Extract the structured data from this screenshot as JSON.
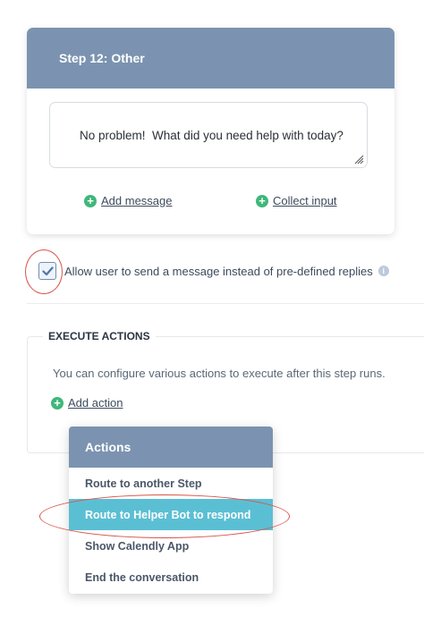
{
  "step": {
    "title": "Step 12: Other",
    "message": "No problem!  What did you need help with today?",
    "add_message_label": "Add message",
    "collect_input_label": "Collect input"
  },
  "settings": {
    "allow_user_message_label": "Allow user to send a message instead of pre-defined replies",
    "allow_user_message_checked": true
  },
  "execute_actions": {
    "title": "EXECUTE ACTIONS",
    "description": "You can configure various actions to execute after this step runs.",
    "add_action_label": "Add action"
  },
  "actions_dropdown": {
    "header": "Actions",
    "items": [
      {
        "label": "Route to another Step",
        "highlighted": false
      },
      {
        "label": "Route to Helper Bot to respond",
        "highlighted": true
      },
      {
        "label": "Show Calendly App",
        "highlighted": false
      },
      {
        "label": "End the conversation",
        "highlighted": false
      }
    ]
  },
  "icons": {
    "plus": "plus-circle-icon",
    "check": "checkmark-icon",
    "info": "info-icon",
    "resize": "resize-grip-icon"
  },
  "colors": {
    "header_bg": "#7b93b0",
    "highlight_bg": "#5bbfd4",
    "plus_green": "#3fb77a",
    "annotation_red": "#d9544a"
  }
}
